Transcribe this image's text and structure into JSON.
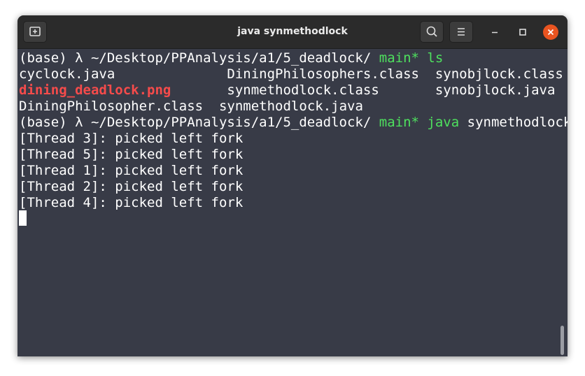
{
  "window": {
    "title": "java synmethodlock"
  },
  "header": {
    "new_tab_icon": "new-tab-icon",
    "search_icon": "search-icon",
    "menu_icon": "hamburger-menu-icon",
    "minimize_icon": "minimize-icon",
    "maximize_icon": "maximize-icon",
    "close_icon": "close-icon"
  },
  "colors": {
    "terminal_bg": "#383b47",
    "titlebar_bg": "#2b2b2b",
    "text": "#ffffff",
    "git_branch": "#4ee05e",
    "image_file": "#f54b4b",
    "close_button": "#e95420"
  },
  "terminal": {
    "prompt1": {
      "prefix": "(base) λ ~/Desktop/PPAnalysis/a1/5_deadlock/ ",
      "branch": "main*",
      "space": " ",
      "command": "ls"
    },
    "ls_rows": [
      {
        "col1": "cyclock.java              ",
        "col2": "DiningPhilosophers.class  ",
        "col3": "synobjlock.class"
      },
      {
        "col1": "dining_deadlock.png",
        "gap": "       ",
        "col2": "synmethodlock.class       ",
        "col3": "synobjlock.java"
      },
      {
        "col1": "DiningPhilosopher.class  ",
        "col2": "synmethodlock.java",
        "col3": ""
      }
    ],
    "prompt2": {
      "prefix": "(base) λ ~/Desktop/PPAnalysis/a1/5_deadlock/ ",
      "branch": "main*",
      "space": " ",
      "command": "java",
      "space2": " ",
      "args": "synmethodlock"
    },
    "output": [
      "[Thread 3]: picked left fork",
      "[Thread 5]: picked left fork",
      "[Thread 1]: picked left fork",
      "[Thread 2]: picked left fork",
      "[Thread 4]: picked left fork"
    ]
  }
}
